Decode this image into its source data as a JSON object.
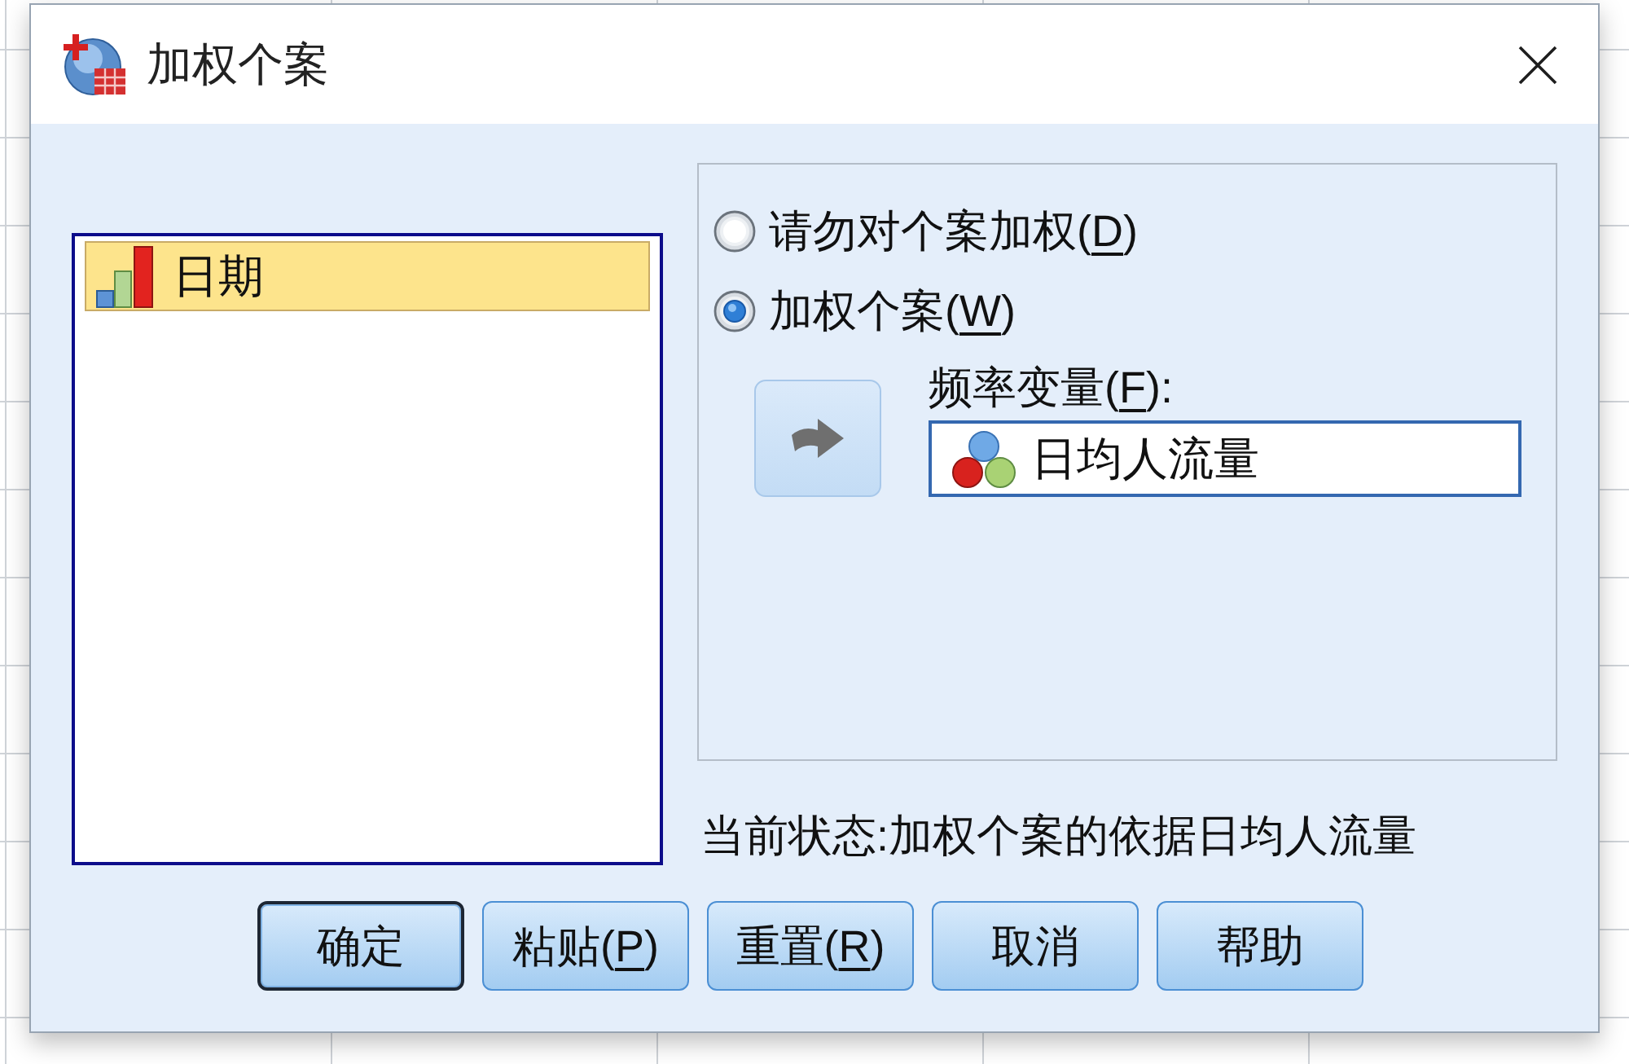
{
  "window": {
    "title": "加权个案"
  },
  "variable_list": {
    "items": [
      {
        "label": "日期",
        "kind": "ordinal",
        "selected": true
      }
    ]
  },
  "weight_options": [
    {
      "label_before": "请勿对个案加权(",
      "access_key": "D",
      "label_after": ")",
      "selected": false
    },
    {
      "label_before": "加权个案(",
      "access_key": "W",
      "label_after": ")",
      "selected": true
    }
  ],
  "frequency_variable": {
    "label_before": "频率变量(",
    "access_key": "F",
    "label_after": "):",
    "value": "日均人流量",
    "kind": "nominal"
  },
  "status": "当前状态:加权个案的依据日均人流量",
  "buttons": [
    {
      "label": "确定",
      "default": true
    },
    {
      "label_before": "粘贴(",
      "access_key": "P",
      "label_after": ")",
      "default": false
    },
    {
      "label_before": "重置(",
      "access_key": "R",
      "label_after": ")",
      "default": false
    },
    {
      "label": "取消",
      "default": false
    },
    {
      "label": "帮助",
      "default": false
    }
  ]
}
